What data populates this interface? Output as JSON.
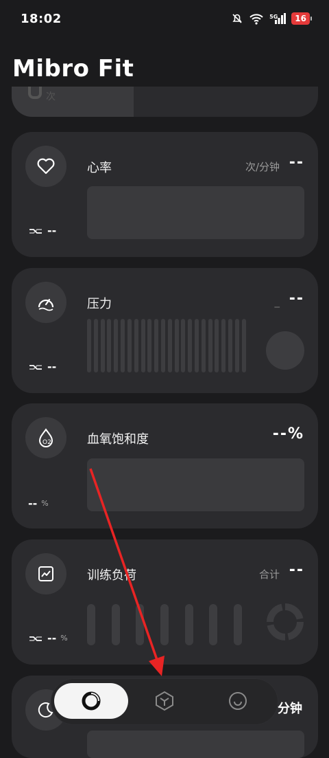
{
  "status": {
    "time": "18:02",
    "network": "5G",
    "battery": "16"
  },
  "app": {
    "title": "Mibro Fit"
  },
  "partial_card": {
    "unit": "次"
  },
  "heart": {
    "title": "心率",
    "unit": "次/分钟",
    "value": "--",
    "mini": "--"
  },
  "stress": {
    "title": "压力",
    "unit": "_",
    "value": "--",
    "mini": "--"
  },
  "spo2": {
    "title": "血氧饱和度",
    "value": "--%",
    "mini_value": "--",
    "mini_unit": "%"
  },
  "load": {
    "title": "训练负荷",
    "unit": "合计",
    "value": "--",
    "mini_value": "--",
    "mini_unit": "%"
  },
  "sleep": {
    "unit": "分钟",
    "value": "--- -- ---"
  },
  "tabs": [
    "home-tab",
    "devices-tab",
    "profile-tab"
  ],
  "colors": {
    "background": "#1b1b1d",
    "card": "#2b2b2e",
    "accent": "#e53a3a"
  }
}
